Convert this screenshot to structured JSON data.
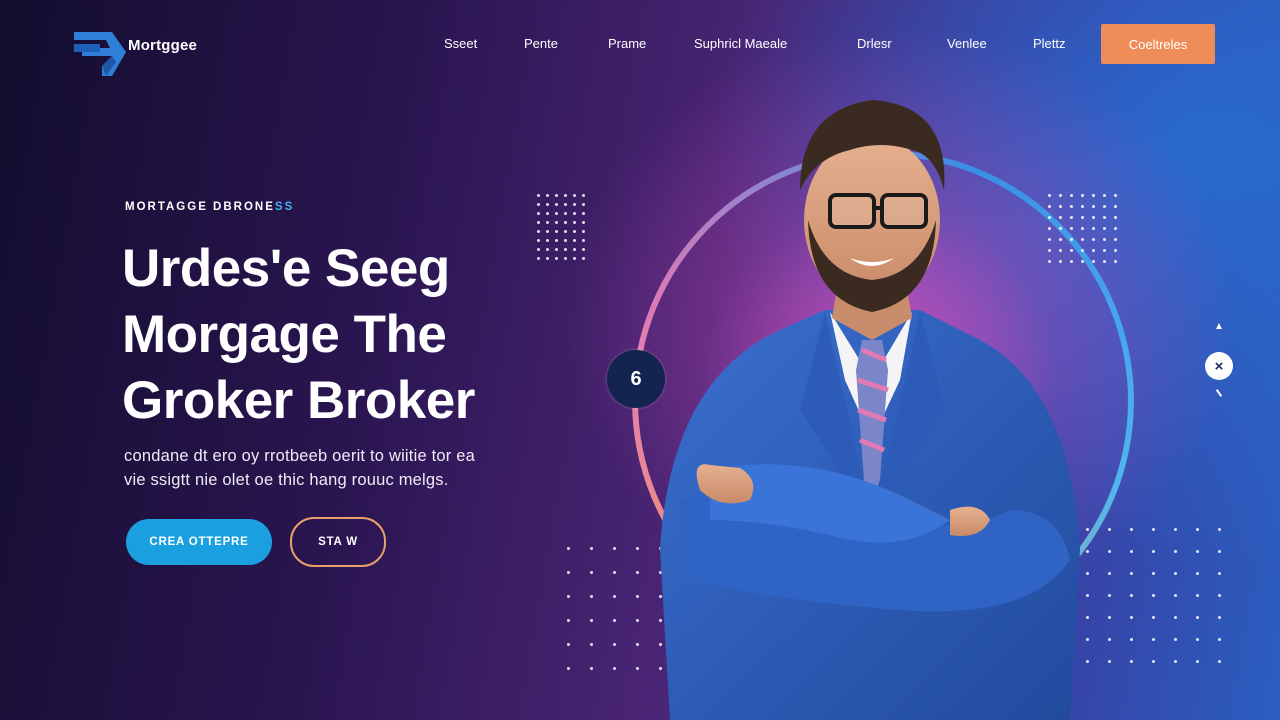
{
  "brand": {
    "name": "Mortggee"
  },
  "nav": {
    "items": [
      "Sseet",
      "Pente",
      "Prame",
      "Suphricl Maeale",
      "Drlesr",
      "Venlee",
      "Plettz"
    ],
    "cta_label": "Coeltreles"
  },
  "hero": {
    "eyebrow": "MORTAGGE DBRONE",
    "eyebrow_accent": "SS",
    "headline": [
      "Urdes'e Seeg",
      "Morgage The",
      "Groker Broker"
    ],
    "subtext": [
      "condane dt ero oy rrotbeeb oerit to wiitie tor ea",
      "vie ssigtt nie olet oe thic hang rouuc melgs."
    ],
    "primary_button": "CREA OTTEPRE",
    "secondary_button": "STA W"
  },
  "badge": {
    "number": "6"
  },
  "close_symbol": "×",
  "colors": {
    "accent_orange": "#ef8d58",
    "accent_blue": "#1aa0e0",
    "eyebrow_accent": "#43b3ee"
  },
  "icons": [
    "logo-mark-icon",
    "close-icon"
  ]
}
